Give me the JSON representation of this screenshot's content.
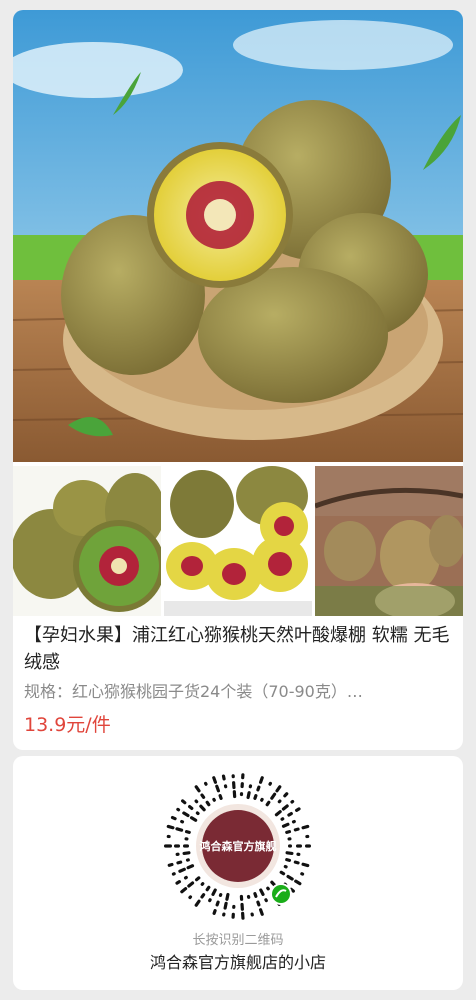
{
  "product": {
    "title": "【孕妇水果】浦江红心猕猴桃天然叶酸爆棚 软糯 无毛绒感",
    "spec": "规格：红心猕猴桃园子货24个装（70-90克）…",
    "price": "13.9元/件",
    "images": {
      "hero": "kiwi-basket-photo",
      "thumb_1": "kiwi-halves-photo",
      "thumb_2": "kiwi-slices-plate-photo",
      "thumb_3": "kiwi-on-vine-photo"
    }
  },
  "mini_program": {
    "logo_text": "鸿合森官方旗舰",
    "hint": "长按识别二维码",
    "shop_name": "鸿合森官方旗舰店的小店"
  },
  "colors": {
    "price": "#e0453b",
    "background": "#ececec",
    "kiwi_flesh": "#e8d84a",
    "kiwi_core": "#b2233a"
  }
}
